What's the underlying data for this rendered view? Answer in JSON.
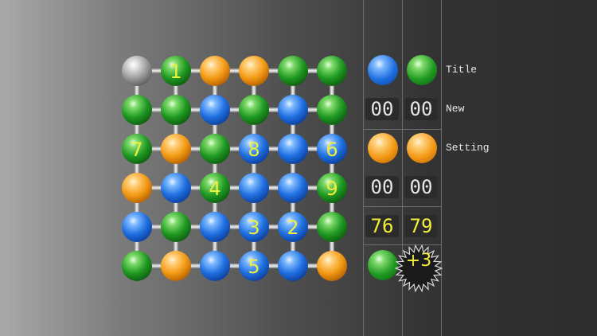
{
  "board": {
    "rows": [
      [
        {
          "color": "gray",
          "n": ""
        },
        {
          "color": "green",
          "n": "1"
        },
        {
          "color": "orange",
          "n": ""
        },
        {
          "color": "orange",
          "n": ""
        },
        {
          "color": "green",
          "n": ""
        },
        {
          "color": "green",
          "n": ""
        }
      ],
      [
        {
          "color": "green",
          "n": ""
        },
        {
          "color": "green",
          "n": ""
        },
        {
          "color": "blue",
          "n": ""
        },
        {
          "color": "green",
          "n": ""
        },
        {
          "color": "blue",
          "n": ""
        },
        {
          "color": "green",
          "n": ""
        }
      ],
      [
        {
          "color": "green",
          "n": "7"
        },
        {
          "color": "orange",
          "n": ""
        },
        {
          "color": "green",
          "n": ""
        },
        {
          "color": "blue",
          "n": "8"
        },
        {
          "color": "blue",
          "n": ""
        },
        {
          "color": "blue",
          "n": "6"
        }
      ],
      [
        {
          "color": "orange",
          "n": ""
        },
        {
          "color": "blue",
          "n": ""
        },
        {
          "color": "green",
          "n": "4"
        },
        {
          "color": "blue",
          "n": ""
        },
        {
          "color": "blue",
          "n": ""
        },
        {
          "color": "green",
          "n": "9"
        }
      ],
      [
        {
          "color": "blue",
          "n": ""
        },
        {
          "color": "green",
          "n": ""
        },
        {
          "color": "blue",
          "n": ""
        },
        {
          "color": "blue",
          "n": "3"
        },
        {
          "color": "blue",
          "n": "2"
        },
        {
          "color": "green",
          "n": ""
        }
      ],
      [
        {
          "color": "green",
          "n": ""
        },
        {
          "color": "orange",
          "n": ""
        },
        {
          "color": "blue",
          "n": ""
        },
        {
          "color": "blue",
          "n": "5"
        },
        {
          "color": "blue",
          "n": ""
        },
        {
          "color": "orange",
          "n": ""
        }
      ]
    ]
  },
  "colors": {
    "number": "#f2ef3a",
    "connector": "#cfcfcf"
  },
  "sidebar": {
    "player1": {
      "ball_color": "blue",
      "score_a": "00",
      "score_b": "00",
      "total": "76"
    },
    "player2": {
      "ball_color": "green",
      "score_a": "00",
      "score_b": "00",
      "total": "79"
    },
    "orange_left": "orange",
    "orange_right": "orange",
    "next_ball": "green",
    "bonus": "+3"
  },
  "menu": {
    "title": "Title",
    "new": "New",
    "setting": "Setting"
  }
}
